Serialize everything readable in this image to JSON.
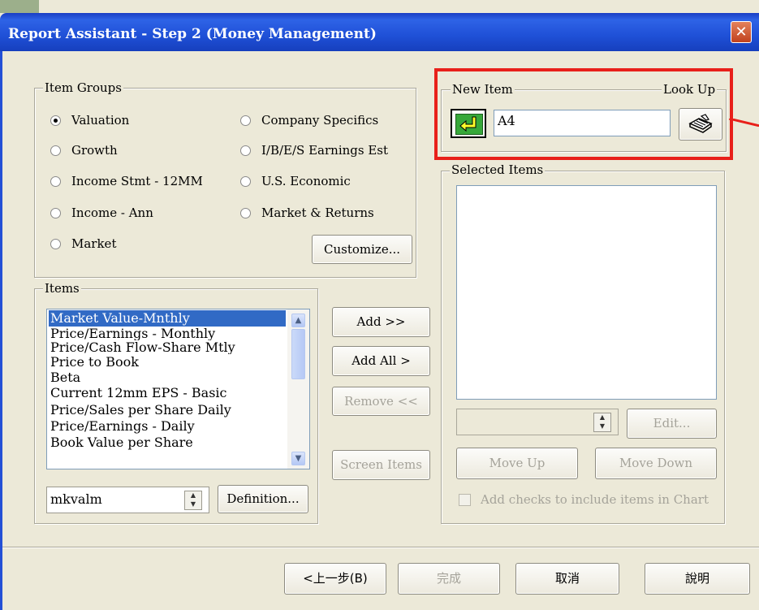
{
  "window": {
    "title": "Report Assistant - Step 2   (Money Management)",
    "close_glyph": "✕"
  },
  "item_groups": {
    "legend": "Item Groups",
    "options": [
      {
        "label": "Valuation",
        "selected": true
      },
      {
        "label": "Growth",
        "selected": false
      },
      {
        "label": "Income Stmt - 12MM",
        "selected": false
      },
      {
        "label": "Income - Ann",
        "selected": false
      },
      {
        "label": "Market",
        "selected": false
      },
      {
        "label": "Company Specifics",
        "selected": false
      },
      {
        "label": "I/B/E/S Earnings Est",
        "selected": false
      },
      {
        "label": "U.S. Economic",
        "selected": false
      },
      {
        "label": "Market & Returns",
        "selected": false
      }
    ],
    "customize_label": "Customize..."
  },
  "items": {
    "legend": "Items",
    "list": [
      "Market Value-Mnthly",
      "Price/Earnings - Monthly",
      "Price/Cash Flow-Share Mtly",
      "Price to Book",
      "Beta",
      "Current 12mm EPS - Basic",
      "Price/Sales per Share Daily",
      "Price/Earnings - Daily",
      "Book Value per Share"
    ],
    "selected_index": 0,
    "code_value": "mkvalm",
    "definition_label": "Definition..."
  },
  "middle_buttons": {
    "add": "Add >>",
    "add_all": "Add All >",
    "remove": "Remove <<",
    "screen_items": "Screen Items"
  },
  "new_item": {
    "legend": "New Item",
    "lookup_label": "Look Up",
    "value": "A4"
  },
  "selected_items": {
    "legend": "Selected Items",
    "edit_label": "Edit...",
    "move_up": "Move Up",
    "move_down": "Move Down",
    "chart_checkbox_label": "Add checks to include items in Chart"
  },
  "footer": {
    "back": "<上一步(B)",
    "finish": "完成",
    "cancel": "取消",
    "help": "說明"
  },
  "colors": {
    "titlebar": "#1f50d7",
    "highlight_box": "#e8201a",
    "selection": "#316ac5",
    "dialog_bg": "#ece9d8"
  }
}
